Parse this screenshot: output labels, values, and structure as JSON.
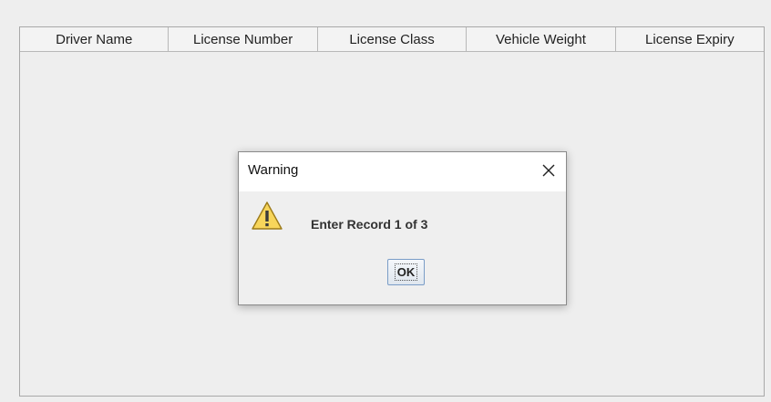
{
  "table": {
    "columns": [
      "Driver Name",
      "License Number",
      "License Class",
      "Vehicle Weight",
      "License Expiry"
    ],
    "rows": []
  },
  "dialog": {
    "title": "Warning",
    "message": "Enter Record 1 of 3",
    "ok_label": "OK",
    "icon": "warning-icon",
    "close_icon": "close-icon"
  },
  "colors": {
    "background": "#eeeeee",
    "titlebar": "#ffffff",
    "warning_fill": "#f7d55b",
    "button_border": "#7a9dc7"
  }
}
